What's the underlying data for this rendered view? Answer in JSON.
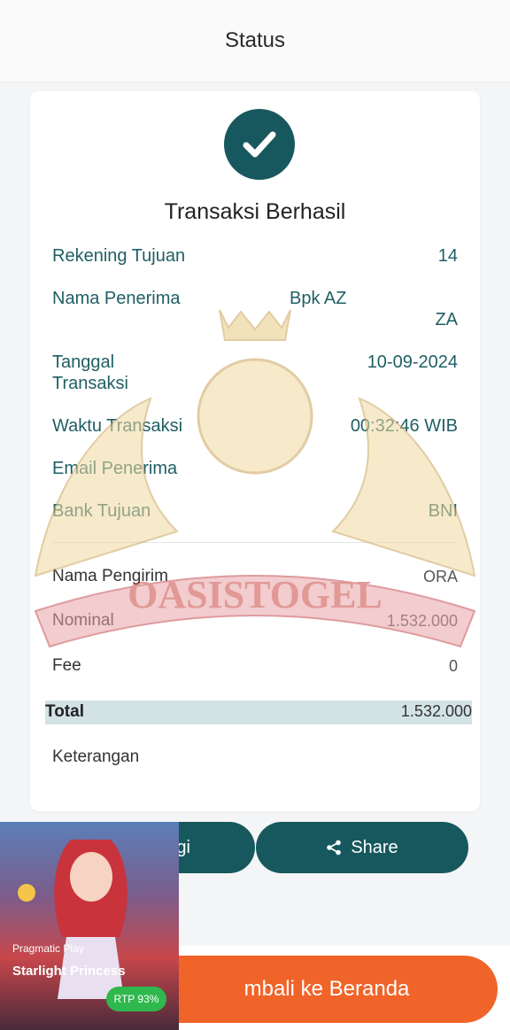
{
  "header": {
    "title": "Status"
  },
  "receipt": {
    "status_title": "Transaksi Berhasil",
    "rows": [
      {
        "label": "Rekening Tujuan",
        "value": "14"
      },
      {
        "label": "Nama Penerima",
        "value_line1": "Bpk AZ",
        "value_line2": "ZA"
      },
      {
        "label_line1": "Tanggal",
        "label_line2": "Transaksi",
        "value": "10-09-2024"
      },
      {
        "label": "Waktu Transaksi",
        "value": "00:32:46 WIB"
      },
      {
        "label": "Email Penerima",
        "value": ""
      },
      {
        "label": "Bank Tujuan",
        "value": "BNI"
      }
    ],
    "details": [
      {
        "label": "Nama Pengirim",
        "value": "ORA"
      },
      {
        "label": "Nominal",
        "value": "1.532.000"
      },
      {
        "label": "Fee",
        "value": "0"
      }
    ],
    "total": {
      "label": "Total",
      "value": "1.532.000"
    },
    "note_label": "Keterangan"
  },
  "watermark": {
    "text": "OASISTOGEL"
  },
  "actions": {
    "again_label": "Lagi",
    "share_label": "Share",
    "home_label": "mbali ke Beranda"
  },
  "promo": {
    "provider": "Pragmatic Play",
    "game": "Starlight Princess",
    "rtp": "RTP 93%"
  },
  "colors": {
    "primary": "#17585e",
    "accent": "#f06429",
    "rtp": "#2eb84d"
  }
}
